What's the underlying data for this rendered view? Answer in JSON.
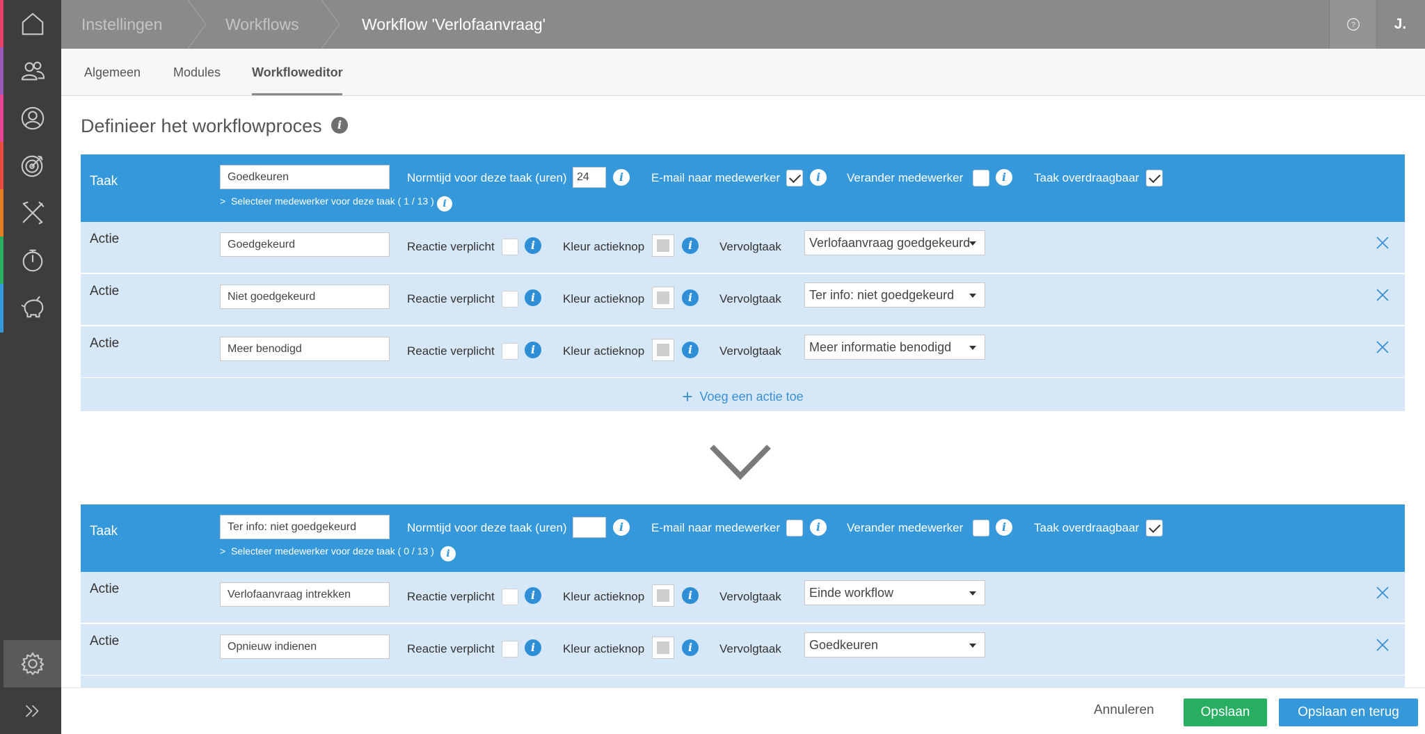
{
  "colors": {
    "accent": "#3498db",
    "action_bg": "#d6e8f7",
    "save_green": "#27ae60",
    "topbar": "#8a8a8a",
    "sidebar": "#3d3d3d",
    "sidebar_stripes": [
      "#e8416b",
      "#9b59b6",
      "#e84393",
      "#e74c3c",
      "#e67e22",
      "#27ae60",
      "#3498db"
    ]
  },
  "sidebar": {
    "items": [
      {
        "icon": "home-icon"
      },
      {
        "icon": "users-icon"
      },
      {
        "icon": "person-icon"
      },
      {
        "icon": "target-icon"
      },
      {
        "icon": "tools-icon"
      },
      {
        "icon": "stopwatch-icon"
      },
      {
        "icon": "piggybank-icon"
      }
    ],
    "settings_icon": "gear-icon",
    "expand_icon": "double-chevron-right-icon"
  },
  "header": {
    "breadcrumbs": [
      "Instellingen",
      "Workflows"
    ],
    "current": "Workflow 'Verlofaanvraag'",
    "help_icon": "question-circle-icon",
    "user_initial": "J."
  },
  "tabs": [
    "Algemeen",
    "Modules",
    "Workfloweditor"
  ],
  "active_tab": "Workfloweditor",
  "page_title": "Definieer het workflowproces",
  "labels": {
    "taak": "Taak",
    "actie": "Actie",
    "normtijd": "Normtijd voor deze taak (uren)",
    "email": "E-mail naar medewerker",
    "verander": "Verander medewerker",
    "overdraagbaar": "Taak overdraagbaar",
    "reactie": "Reactie verplicht",
    "kleur": "Kleur actieknop",
    "vervolgtaak": "Vervolgtaak",
    "add_action": "Voeg een actie toe"
  },
  "tasks": [
    {
      "name": "Goedkeuren",
      "normtijd": "24",
      "email": true,
      "verander": false,
      "overdraagbaar": true,
      "select_employee": "Selecteer medewerker voor deze taak ( 1 / 13 )",
      "actions": [
        {
          "name": "Goedgekeurd",
          "reactie": false,
          "vervolgtaak": "Verlofaanvraag goedgekeurd"
        },
        {
          "name": "Niet goedgekeurd",
          "reactie": false,
          "vervolgtaak": "Ter info: niet goedgekeurd"
        },
        {
          "name": "Meer benodigd",
          "reactie": false,
          "vervolgtaak": "Meer informatie benodigd"
        }
      ]
    },
    {
      "name": "Ter info: niet goedgekeurd",
      "normtijd": "",
      "email": false,
      "verander": false,
      "overdraagbaar": true,
      "select_employee": "Selecteer medewerker voor deze taak ( 0 / 13 )",
      "actions": [
        {
          "name": "Verlofaanvraag intrekken",
          "reactie": false,
          "vervolgtaak": "Einde workflow"
        },
        {
          "name": "Opnieuw indienen",
          "reactie": false,
          "vervolgtaak": "Goedkeuren"
        }
      ]
    }
  ],
  "footer": {
    "cancel": "Annuleren",
    "save": "Opslaan",
    "save_back": "Opslaan en terug"
  }
}
